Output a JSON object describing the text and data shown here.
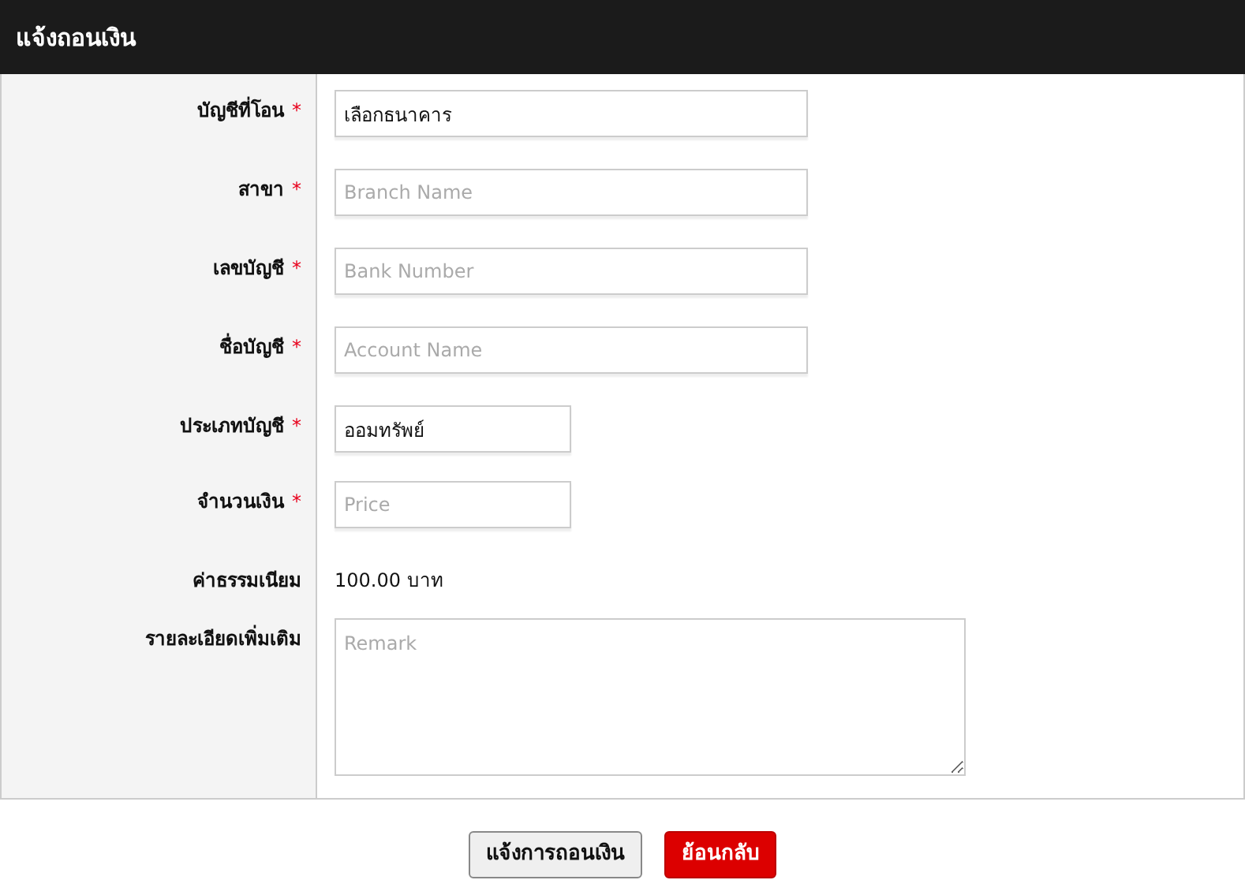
{
  "header": {
    "title": "แจ้งถอนเงิน"
  },
  "fields": [
    {
      "label": "บัญชีที่โอน",
      "mark": "*",
      "kind": "select",
      "value": "เลือกธนาคาร"
    },
    {
      "label": "สาขา",
      "mark": "*",
      "kind": "text",
      "placeholder": "Branch Name"
    },
    {
      "label": "เลขบัญชี",
      "mark": "*",
      "kind": "text",
      "placeholder": "Bank Number"
    },
    {
      "label": "ชื่อบัญชี",
      "mark": "*",
      "kind": "text",
      "placeholder": "Account Name"
    },
    {
      "label": "ประเภทบัญชี",
      "mark": "*",
      "kind": "select",
      "value": "ออมทรัพย์"
    },
    {
      "label": "จำนวนเงิน",
      "mark": "*",
      "kind": "text",
      "placeholder": "Price"
    },
    {
      "label": "ค่าธรรมเนียม",
      "kind": "static",
      "value": "100.00 บาท"
    },
    {
      "label": "รายละเอียดเพิ่มเติม",
      "kind": "textarea",
      "placeholder": "Remark"
    }
  ],
  "buttons": [
    {
      "label": "แจ้งการถอนเงิน",
      "kind": "default"
    },
    {
      "label": "ย้อนกลับ",
      "kind": "danger"
    }
  ]
}
